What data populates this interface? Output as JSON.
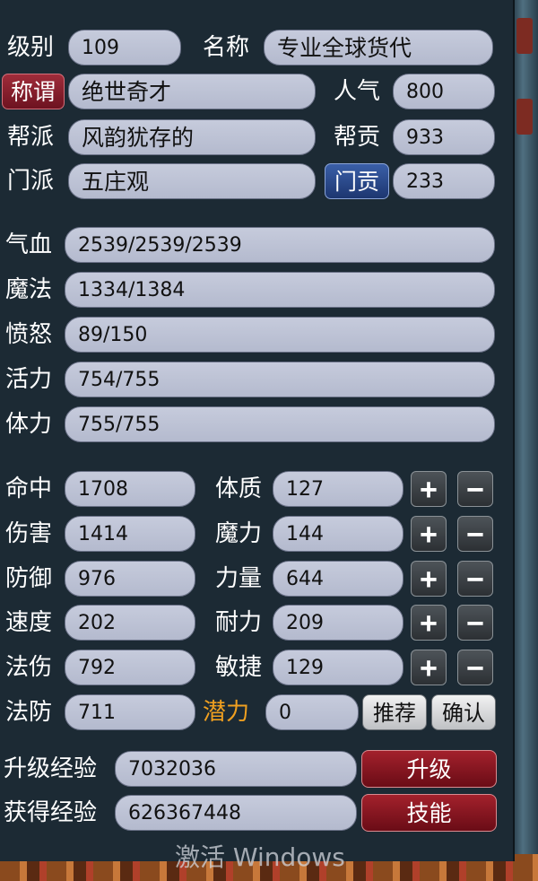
{
  "basic": {
    "level_label": "级别",
    "level_value": "109",
    "name_label": "名称",
    "name_value": "专业全球货代",
    "title_button": "称谓",
    "title_value": "绝世奇才",
    "popularity_label": "人气",
    "popularity_value": "800",
    "guild_label": "帮派",
    "guild_value": "风韵犹存的",
    "guild_contrib_label": "帮贡",
    "guild_contrib_value": "933",
    "sect_label": "门派",
    "sect_value": "五庄观",
    "sect_contrib_button": "门贡",
    "sect_contrib_value": "233"
  },
  "vitals": [
    {
      "label": "气血",
      "value": "2539/2539/2539"
    },
    {
      "label": "魔法",
      "value": "1334/1384"
    },
    {
      "label": "愤怒",
      "value": "89/150"
    },
    {
      "label": "活力",
      "value": "754/755"
    },
    {
      "label": "体力",
      "value": "755/755"
    }
  ],
  "combat": [
    {
      "label": "命中",
      "value": "1708"
    },
    {
      "label": "伤害",
      "value": "1414"
    },
    {
      "label": "防御",
      "value": "976"
    },
    {
      "label": "速度",
      "value": "202"
    },
    {
      "label": "法伤",
      "value": "792"
    },
    {
      "label": "法防",
      "value": "711"
    }
  ],
  "attributes": [
    {
      "label": "体质",
      "value": "127"
    },
    {
      "label": "魔力",
      "value": "144"
    },
    {
      "label": "力量",
      "value": "644"
    },
    {
      "label": "耐力",
      "value": "209"
    },
    {
      "label": "敏捷",
      "value": "129"
    }
  ],
  "potential": {
    "label": "潜力",
    "value": "0"
  },
  "adjust": {
    "plus": "+",
    "minus": "−"
  },
  "buttons": {
    "recommend": "推荐",
    "confirm": "确认",
    "level_up": "升级",
    "skills": "技能"
  },
  "experience": {
    "upgrade_label": "升级经验",
    "upgrade_value": "7032036",
    "gained_label": "获得经验",
    "gained_value": "626367448"
  },
  "watermark": "激活 Windows",
  "colors": {
    "panel": "#1c2a34",
    "field": "#c6cbdc",
    "accent_red": "#8a1a26",
    "potential_orange": "#f0a020"
  }
}
